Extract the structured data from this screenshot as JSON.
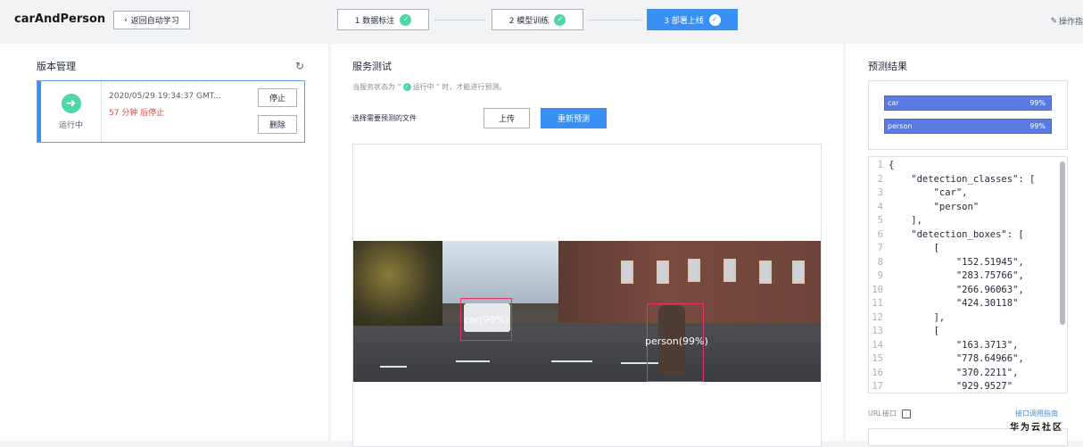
{
  "header": {
    "app_title": "carAndPerson",
    "back_label": "返回自动学习",
    "steps": [
      {
        "label": "1 数据标注",
        "status": "done"
      },
      {
        "label": "2 模型训练",
        "status": "done"
      },
      {
        "label": "3 部署上线",
        "status": "active"
      }
    ],
    "op_guide": "操作指"
  },
  "version": {
    "title": "版本管理",
    "status": "运行中",
    "date": "2020/05/29 19:34:37 GMT...",
    "stop_notice": "57 分钟 后停止",
    "stop_label": "停止",
    "delete_label": "删除"
  },
  "service": {
    "title": "服务测试",
    "hint_prefix": "当服务状态为 “",
    "hint_status": "运行中",
    "hint_suffix": "” 时，才能进行预测。",
    "file_label": "选择需要预测的文件",
    "upload_label": "上传",
    "repredict_label": "重新预测",
    "detections": [
      {
        "label": "car(99%)"
      },
      {
        "label": "person(99%)"
      }
    ]
  },
  "result": {
    "title": "预测结果",
    "predictions": [
      {
        "label": "car",
        "score": "99%"
      },
      {
        "label": "person",
        "score": "99%"
      }
    ],
    "json_lines": [
      {
        "n": "1",
        "t": "{"
      },
      {
        "n": "2",
        "t": "    \"detection_classes\": ["
      },
      {
        "n": "3",
        "t": "        \"car\","
      },
      {
        "n": "4",
        "t": "        \"person\""
      },
      {
        "n": "5",
        "t": "    ],"
      },
      {
        "n": "6",
        "t": "    \"detection_boxes\": ["
      },
      {
        "n": "7",
        "t": "        ["
      },
      {
        "n": "8",
        "t": "            \"152.51945\","
      },
      {
        "n": "9",
        "t": "            \"283.75766\","
      },
      {
        "n": "10",
        "t": "            \"266.96063\","
      },
      {
        "n": "11",
        "t": "            \"424.30118\""
      },
      {
        "n": "12",
        "t": "        ],"
      },
      {
        "n": "13",
        "t": "        ["
      },
      {
        "n": "14",
        "t": "            \"163.3713\","
      },
      {
        "n": "15",
        "t": "            \"778.64966\","
      },
      {
        "n": "16",
        "t": "            \"370.2211\","
      },
      {
        "n": "17",
        "t": "            \"929.9527\""
      }
    ],
    "url_label": "URL接口",
    "api_guide": "接口调用指南"
  },
  "watermark": "华为云社区",
  "colors": {
    "accent": "#3a8ff5",
    "success": "#50d4ab",
    "danger": "#e6433e",
    "bbox": "#e8336b",
    "bar": "#5b7ae0"
  }
}
